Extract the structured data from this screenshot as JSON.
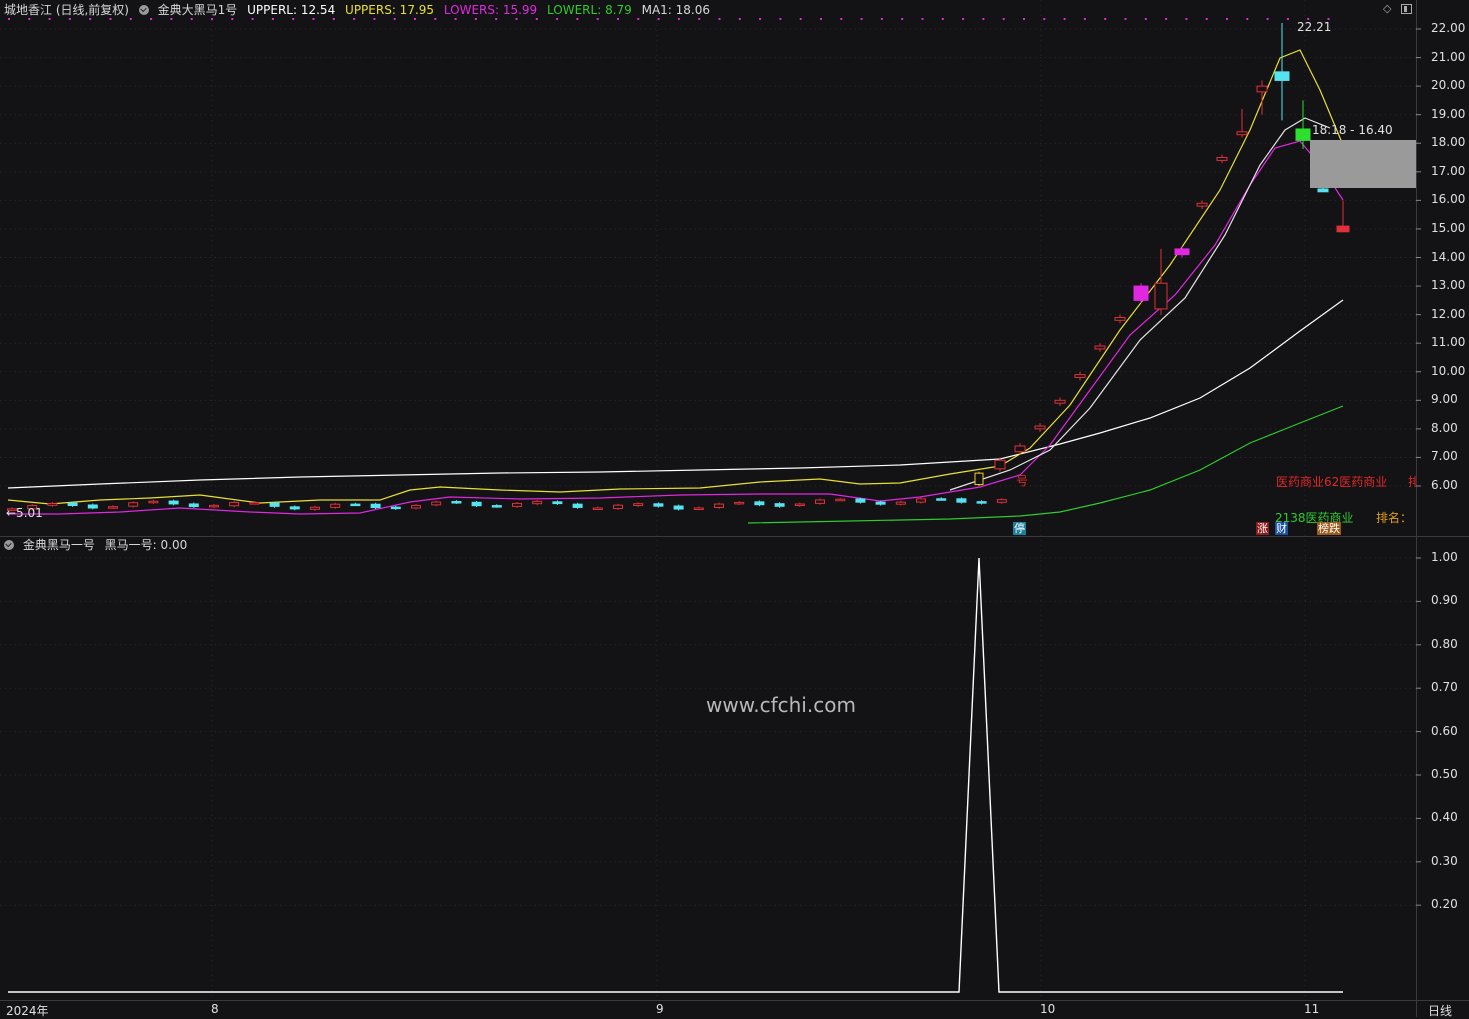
{
  "header": {
    "stock": "城地香江 (日线,前复权)",
    "indicator": "金典大黑马1号",
    "upperl": "UPPERL: 12.54",
    "uppers": "UPPERS: 17.95",
    "lowers": "LOWERS: 15.99",
    "lowerl": "LOWERL: 8.79",
    "ma1": "MA1: 18.06"
  },
  "sub_header": {
    "indicator": "金典黑马一号",
    "value": "黑马一号: 0.00"
  },
  "price_axis": [
    "22.00",
    "21.00",
    "20.00",
    "19.00",
    "18.00",
    "17.00",
    "16.00",
    "15.00",
    "14.00",
    "13.00",
    "12.00",
    "11.00",
    "10.00",
    "9.00",
    "8.00",
    "7.00",
    "6.00"
  ],
  "sub_axis": [
    "1.00",
    "0.90",
    "0.80",
    "0.70",
    "0.60",
    "0.50",
    "0.40",
    "0.30",
    "0.20"
  ],
  "time_axis": [
    "2024年",
    "8",
    "9",
    "10",
    "11"
  ],
  "period_label": "日线",
  "annotations": {
    "high": "22.21",
    "low": "←5.01",
    "range": "18.18 - 16.40",
    "sector_red": "医药商业62医药商业",
    "sector_red_extra": "排",
    "sector_green": "2138医药商业",
    "rank": "排名：",
    "signal_text": "号",
    "badge_ting": "停",
    "badge_zhang": "涨",
    "badge_cai": "财",
    "badge_bang": "榜跌"
  },
  "watermark": "www.cfchi.com",
  "colors": {
    "background": "#131215",
    "upperl": "#ffffff",
    "uppers": "#e8e032",
    "lowers": "#e028e0",
    "lowerl": "#2ecc2e",
    "up_candle": "#e0303a",
    "down_candle": "#54e4f0"
  },
  "icons": [
    "check-circle-icon",
    "diamond-icon",
    "window-icon"
  ],
  "chart_data": {
    "type": "line",
    "sub_series": {
      "name": "黑马一号",
      "peak": 1.0,
      "value": 0.0
    },
    "price_extremes": {
      "high": 22.21,
      "low": 5.01
    }
  }
}
